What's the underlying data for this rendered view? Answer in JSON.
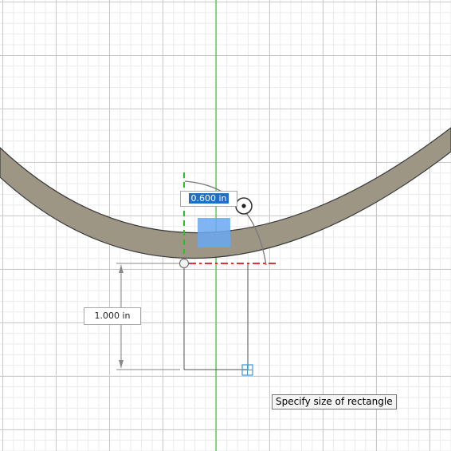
{
  "canvas": {
    "background_color": "#ffffff",
    "grid_minor_color": "#ebebeb",
    "grid_major_color": "#c9c9c9",
    "axis_color": "#3ccf3c"
  },
  "dimension_inputs": {
    "width_value": "0.600 in",
    "height_value": "1.000 in"
  },
  "tooltip": {
    "text": "Specify size of rectangle"
  },
  "colors": {
    "ring_fill": "#9d9685",
    "preview_fill": "#6aa8f2",
    "constraint_red": "#e03030",
    "selection_blue": "#1f6fc5"
  },
  "icons": {
    "drag_handle": "angle-drag-handle-icon",
    "point": "sketch-point-icon",
    "cursor": "rectangle-cursor-icon"
  }
}
